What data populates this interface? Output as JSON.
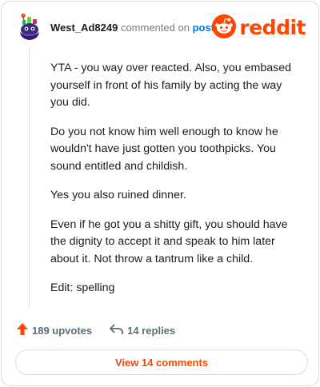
{
  "comment": {
    "author": "West_Ad8249",
    "commented_text": "commented on",
    "post_link": "post",
    "paragraphs": [
      "YTA - you way over reacted. Also, you embased yourself in front of his family by acting the way you did.",
      "Do you not know him well enough to know he wouldn't have just gotten you toothpicks. You sound entitled and childish.",
      "Yes you also ruined dinner.",
      "Even if he got you a shitty gift, you should have the dignity to accept it and speak to him later about it. Not throw a tantrum like a child.",
      "Edit: spelling"
    ]
  },
  "logo": {
    "text": "reddit",
    "icon": "reddit-snoo-icon"
  },
  "stats": {
    "upvotes": "189 upvotes",
    "replies": "14 replies",
    "upvote_icon": "upvote-arrow-icon",
    "reply_icon": "reply-arrow-icon"
  },
  "view_button": {
    "label": "View 14 comments"
  },
  "colors": {
    "brand": "#ff4500",
    "link": "#0079d3",
    "meta": "#576f76",
    "border": "#dcdcdc"
  }
}
